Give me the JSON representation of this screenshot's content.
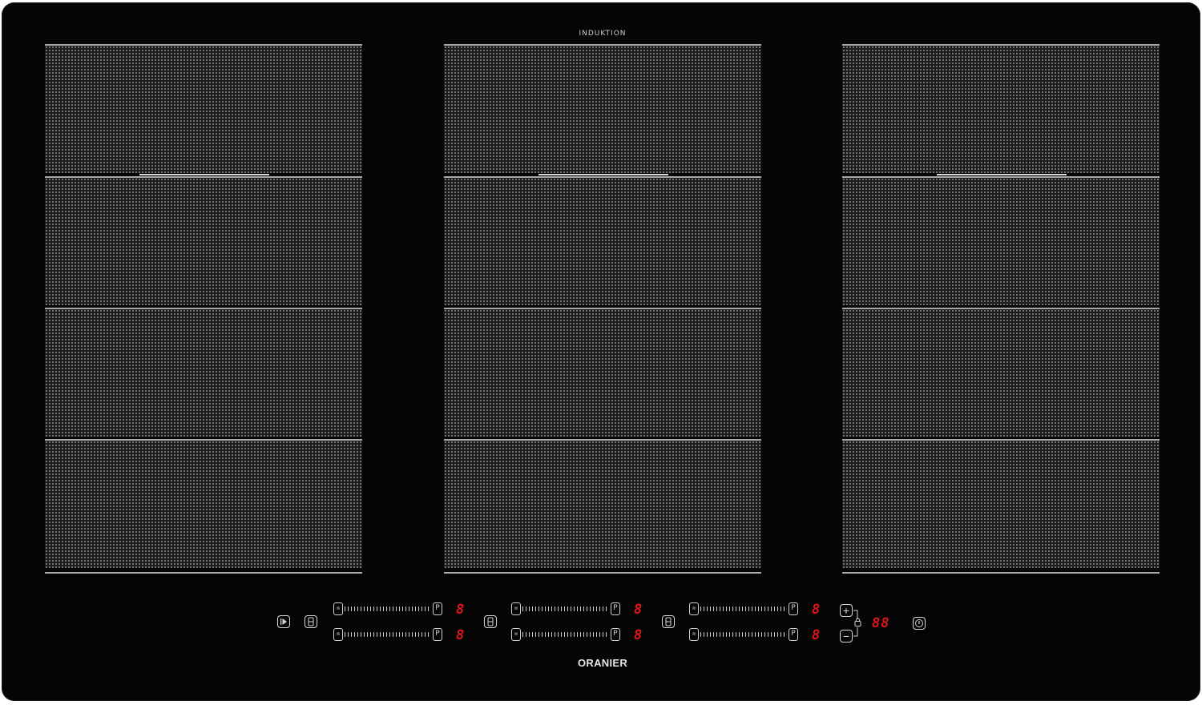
{
  "hob": {
    "label_top": "INDUKTION",
    "brand": "ORANIER",
    "columns": [
      "left",
      "middle",
      "right"
    ],
    "zones_per_column": 4
  },
  "controls": {
    "sliders": [
      {
        "id": "left-top",
        "start_symbol": "≋",
        "boost_symbol": "P",
        "level_display": "8"
      },
      {
        "id": "left-bottom",
        "start_symbol": "≋",
        "boost_symbol": "P",
        "level_display": "8"
      },
      {
        "id": "mid-top",
        "start_symbol": "≋",
        "boost_symbol": "P",
        "level_display": "8"
      },
      {
        "id": "mid-bottom",
        "start_symbol": "≋",
        "boost_symbol": "P",
        "level_display": "8"
      },
      {
        "id": "right-top",
        "start_symbol": "≋",
        "boost_symbol": "P",
        "level_display": "8"
      },
      {
        "id": "right-bottom",
        "start_symbol": "≋",
        "boost_symbol": "P",
        "level_display": "8"
      }
    ],
    "timer_display": "88",
    "plus_symbol": "+",
    "minus_symbol": "−"
  },
  "colors": {
    "surface": "#050505",
    "grid_dots": "#8a8a8a",
    "display_red": "#e0141e",
    "icon_white": "#d8d8d8"
  },
  "icons": [
    "pause-play-icon",
    "bridge-icon",
    "lock-icon",
    "power-icon",
    "plus-icon",
    "minus-icon"
  ]
}
